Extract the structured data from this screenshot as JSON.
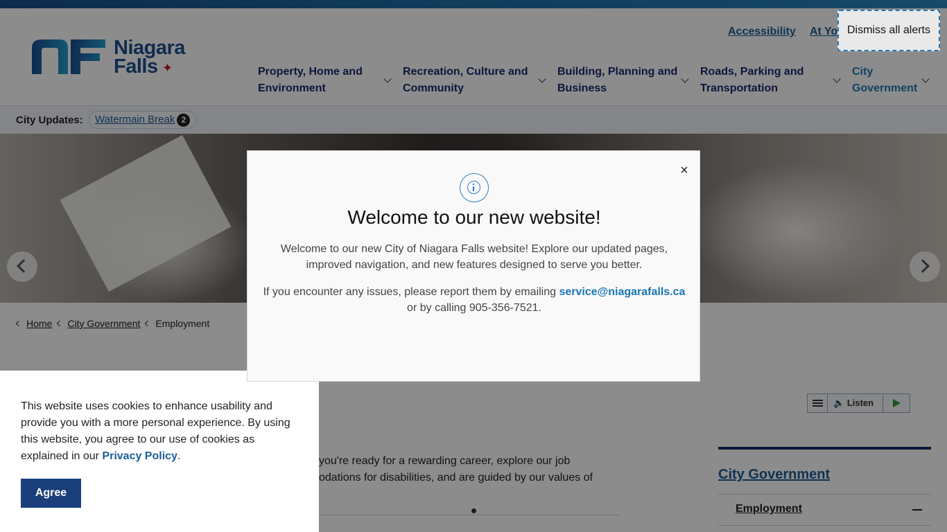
{
  "header": {
    "logo_line1": "Niagara",
    "logo_line2": "Falls",
    "utility_links": [
      "Accessibility",
      "At Yo"
    ],
    "nav": [
      {
        "line1": "Property, Home and",
        "line2": "Environment"
      },
      {
        "line1": "Recreation, Culture and",
        "line2": "Community"
      },
      {
        "line1": "Building, Planning and",
        "line2": "Business"
      },
      {
        "line1": "Roads, Parking and",
        "line2": "Transportation"
      },
      {
        "line1": "City",
        "line2": "Government"
      }
    ]
  },
  "updates": {
    "label": "City Updates:",
    "item": "Watermain Break",
    "count": "2"
  },
  "breadcrumb": [
    "Home",
    "City Government",
    "Employment"
  ],
  "listen": {
    "label": "Listen"
  },
  "body_text": {
    "line1": "you're ready for a rewarding career, explore our job",
    "line2": "odations for disabilities, and are guided by our values of"
  },
  "sidebar": {
    "title": "City Government",
    "item": "Employment"
  },
  "cookie": {
    "text": "This website uses cookies to enhance usability and provide you with a more personal experience. By using this website, you agree to our use of cookies as explained in our ",
    "link": "Privacy Policy",
    "end": ".",
    "agree": "Agree"
  },
  "dismiss": "Dismiss all alerts",
  "modal": {
    "close": "×",
    "title": "Welcome to our new website!",
    "p1": "Welcome to our new City of Niagara Falls website! Explore our updated pages, improved navigation, and new features designed to serve you better.",
    "p2_start": "If you encounter any issues, please report them by emailing ",
    "email": "service@niagarafalls.ca",
    "p2_end": "or by calling 905-356-7521."
  },
  "colors": {
    "brand_blue": "#1d4f91",
    "nav_text": "#1a2a6c",
    "link_blue": "#1d5e96",
    "agree_bg": "#1a3f7a"
  }
}
